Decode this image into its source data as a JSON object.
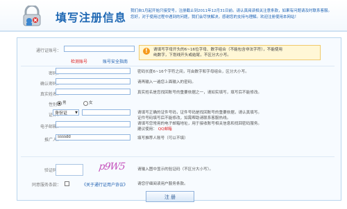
{
  "header": {
    "title": "填写注册信息",
    "notice_lines": [
      "我们自1月起开始只接受号，注册截止到2011年12月31日前。请认真阅读相关注意条款，如果有问题请及时联系客服。",
      "您好，对于使用过程中遇到的问题，我们会尽快解决，感谢您的支持与理解。欢迎注册使用本网站！"
    ]
  },
  "form": {
    "account": {
      "label": "通行证账号：",
      "value": "",
      "hint_lines": [
        "请填写字母开头的6~16位字母、数字组合（不能包含非法字符），不能使用",
        "纯数字，下划线开头或结尾，不区分大小写。"
      ],
      "check_link": "检测账号",
      "security_link": "账号安全指南"
    },
    "password": {
      "label": "密码：",
      "value": "",
      "hint": "密码长度6~16个字符之间，可由数字和字母组合，区分大小写。"
    },
    "confirm_password": {
      "label": "确认密码：",
      "value": "",
      "hint": "请再输入一遍您上面输入的密码。"
    },
    "real_name": {
      "label": "真实姓名：",
      "value": "",
      "hint": "真实姓名是您找回账号的重要依据之一，请如实填写，填写后不能修改。"
    },
    "gender": {
      "label": "性别：",
      "options": [
        "男",
        "女"
      ],
      "selected": "男"
    },
    "id_card": {
      "label": "证件：",
      "type_selected": "身份证",
      "value": "",
      "hint_lines": [
        "请填写正确的证件号码，证件号码是找回账号的重要依据，请认真填写。",
        "证件号码填写后不能修改，如需帮助请联系客服热线。"
      ]
    },
    "email": {
      "label": "电子邮箱：",
      "value": "",
      "hint_lines": [
        "请填写您常用的电子邮箱地址，用于接收账号相关信息和找回密码服务。",
        "建议使用：",
        "QQ邮箱"
      ]
    },
    "referrer": {
      "label": "推广人：",
      "value": "ssssdd",
      "hint": "填写推荐人账号（可以不填）"
    },
    "captcha": {
      "label": "验证码：",
      "value": "",
      "image_text": "p9W5",
      "hint": "请输入图中显示的验证码（不区分大小写）。"
    },
    "agreement": {
      "label": "同意服务条款：",
      "checked": false,
      "link": "《关于通行证用户协议》",
      "hint": "请您仔细阅读用户服务条款。"
    },
    "submit_label": "注 册"
  }
}
